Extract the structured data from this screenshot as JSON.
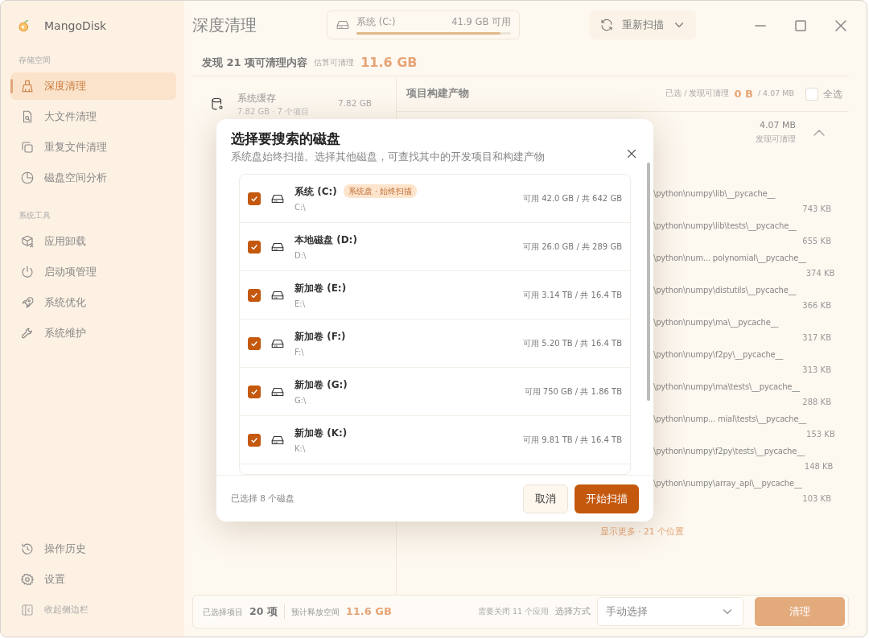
{
  "app": {
    "name": "MangoDisk"
  },
  "sidebar": {
    "sections": [
      {
        "title": "存储空间",
        "items": [
          {
            "label": "深度清理",
            "selected": true
          },
          {
            "label": "大文件清理",
            "selected": false
          },
          {
            "label": "重复文件清理",
            "selected": false
          },
          {
            "label": "磁盘空间分析",
            "selected": false
          }
        ]
      },
      {
        "title": "系统工具",
        "items": [
          {
            "label": "应用卸载",
            "selected": false
          },
          {
            "label": "启动项管理",
            "selected": false
          },
          {
            "label": "系统优化",
            "selected": false
          },
          {
            "label": "系统维护",
            "selected": false
          }
        ]
      }
    ],
    "bottom_items": [
      {
        "label": "操作历史"
      },
      {
        "label": "设置"
      },
      {
        "label": "收起侧边栏"
      }
    ]
  },
  "header": {
    "title": "深度清理",
    "disk": {
      "label": "系统 (C:)",
      "free": "41.9 GB 可用",
      "level": 0.93
    },
    "rescan_button": "重新扫描"
  },
  "summary": {
    "found": "发现 21 项可清理内容",
    "estimate_label": "估算可清理",
    "estimate": "11.6 GB"
  },
  "categories": [
    {
      "name": "系统缓存",
      "detail": "7.82 GB · 7 个项目",
      "size": "7.82 GB"
    }
  ],
  "detail": {
    "title": "项目构建产物",
    "selected_label": "已选 / 发现可清理",
    "selected_size": "0 B",
    "total": "/ 4.07 MB",
    "select_all": {
      "label": "全选",
      "checked": false
    },
    "group": {
      "size": "4.07 MB",
      "caption": "发现可清理",
      "expanded": true
    },
    "paths": [
      {
        "path": "\\python\\numpy\\lib\\__pycache__",
        "size": "743 KB"
      },
      {
        "path": "\\python\\numpy\\lib\\tests\\__pycache__",
        "size": "655 KB"
      },
      {
        "path": "\\python\\num... polynomial\\__pycache__",
        "size": "374 KB"
      },
      {
        "path": "\\python\\numpy\\distutils\\__pycache__",
        "size": "366 KB"
      },
      {
        "path": "\\python\\numpy\\ma\\__pycache__",
        "size": "317 KB"
      },
      {
        "path": "\\python\\numpy\\f2py\\__pycache__",
        "size": "313 KB"
      },
      {
        "path": "\\python\\numpy\\ma\\tests\\__pycache__",
        "size": "288 KB"
      },
      {
        "path": "\\python\\nump... mial\\tests\\__pycache__",
        "size": "153 KB"
      },
      {
        "path": "\\python\\numpy\\f2py\\tests\\__pycache__",
        "size": "148 KB"
      },
      {
        "path": "\\python\\numpy\\array_api\\__pycache__",
        "size": "103 KB"
      }
    ],
    "show_more": "显示更多 · 21 个位置"
  },
  "footer": {
    "selected_label": "已选择项目",
    "selected_count": "20 项",
    "free_label": "预计释放空间",
    "free_size": "11.6 GB",
    "close_apps": "需要关闭 11 个应用",
    "mode_label": "选择方式",
    "mode_value": "手动选择",
    "clean_button": "清理"
  },
  "dialog": {
    "title": "选择要搜索的磁盘",
    "subtitle": "系统盘始终扫描。选择其他磁盘，可查找其中的开发项目和构建产物",
    "drives": [
      {
        "name": "系统 (C:)",
        "badge": "系统盘 · 始终扫描",
        "path": "C:\\",
        "space": "可用 42.0 GB / 共 642 GB",
        "checked": true
      },
      {
        "name": "本地磁盘 (D:)",
        "path": "D:\\",
        "space": "可用 26.0 GB / 共 289 GB",
        "checked": true
      },
      {
        "name": "新加卷 (E:)",
        "path": "E:\\",
        "space": "可用 3.14 TB / 共 16.4 TB",
        "checked": true
      },
      {
        "name": "新加卷 (F:)",
        "path": "F:\\",
        "space": "可用 5.20 TB / 共 16.4 TB",
        "checked": true
      },
      {
        "name": "新加卷 (G:)",
        "path": "G:\\",
        "space": "可用 750 GB / 共 1.86 TB",
        "checked": true
      },
      {
        "name": "新加卷 (K:)",
        "path": "K:\\",
        "space": "可用 9.81 TB / 共 16.4 TB",
        "checked": true
      }
    ],
    "selected_count": "已选择 8 个磁盘",
    "cancel_button": "取消",
    "start_button": "开始扫描"
  }
}
